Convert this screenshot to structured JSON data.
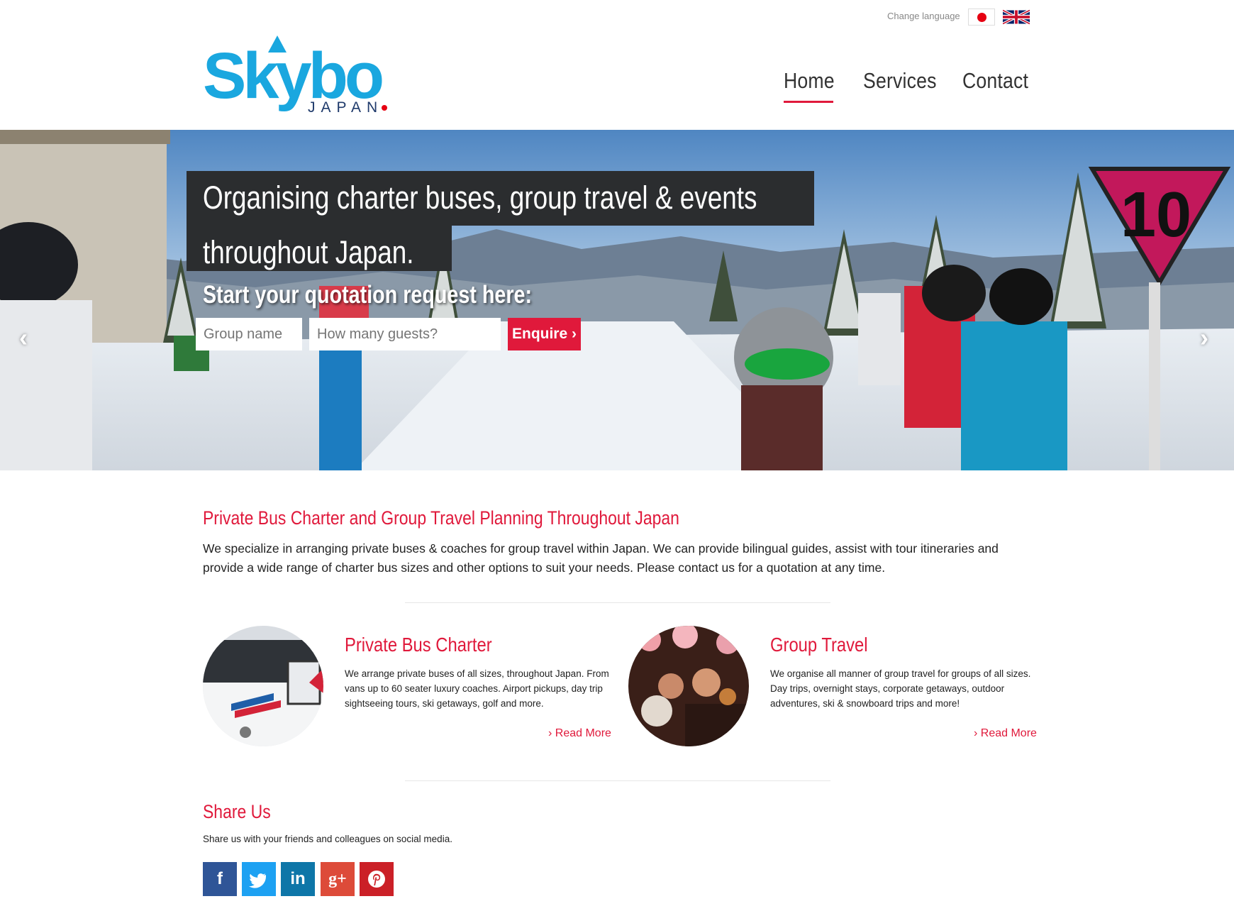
{
  "header": {
    "change_language": "Change language",
    "flags": [
      "japan-flag",
      "uk-flag"
    ],
    "logo": {
      "brand": "Skybo",
      "sub": "JAPAN"
    },
    "nav": [
      {
        "label": "Home",
        "active": true
      },
      {
        "label": "Services",
        "active": false
      },
      {
        "label": "Contact",
        "active": false
      }
    ]
  },
  "hero": {
    "headline_line1": "Organising charter buses, group travel & events",
    "headline_line2": "throughout Japan.",
    "subheading": "Start your quotation request here:",
    "group_name_placeholder": "Group name",
    "guests_placeholder": "How many guests?",
    "enquire_label": "Enquire ›",
    "prev_icon": "chevron-left-icon",
    "next_icon": "chevron-right-icon"
  },
  "intro": {
    "title": "Private Bus Charter and Group Travel Planning Throughout Japan",
    "text": "We specialize in arranging private buses & coaches for group travel within Japan. We can provide bilingual guides, assist with tour itineraries and provide a wide range of charter bus sizes and other options to suit your needs. Please contact us for a quotation at any time."
  },
  "services": [
    {
      "title": "Private Bus Charter",
      "text": "We arrange private buses of all sizes, throughout Japan. From vans up to 60 seater luxury coaches. Airport pickups, day trip sightseeing tours, ski getaways, golf and more.",
      "read_more": "› Read More"
    },
    {
      "title": "Group Travel",
      "text": "We organise all manner of group travel for groups of all sizes. Day trips, overnight stays, corporate getaways, outdoor adventures, ski & snowboard trips and more!",
      "read_more": "› Read More"
    }
  ],
  "share": {
    "title": "Share Us",
    "text": "Share us with your friends and colleagues on social media.",
    "buttons": [
      {
        "icon": "facebook-icon",
        "glyph": "f",
        "color": "#2f5597"
      },
      {
        "icon": "twitter-icon",
        "glyph": "t",
        "color": "#1da1f2"
      },
      {
        "icon": "linkedin-icon",
        "glyph": "in",
        "color": "#0e76a8"
      },
      {
        "icon": "google-plus-icon",
        "glyph": "g+",
        "color": "#dd4b39"
      },
      {
        "icon": "pinterest-icon",
        "glyph": "P",
        "color": "#cb2027"
      }
    ]
  },
  "colors": {
    "accent": "#e0193b",
    "brand_blue": "#1aa7df",
    "headline_bg": "#2b2d2f"
  }
}
